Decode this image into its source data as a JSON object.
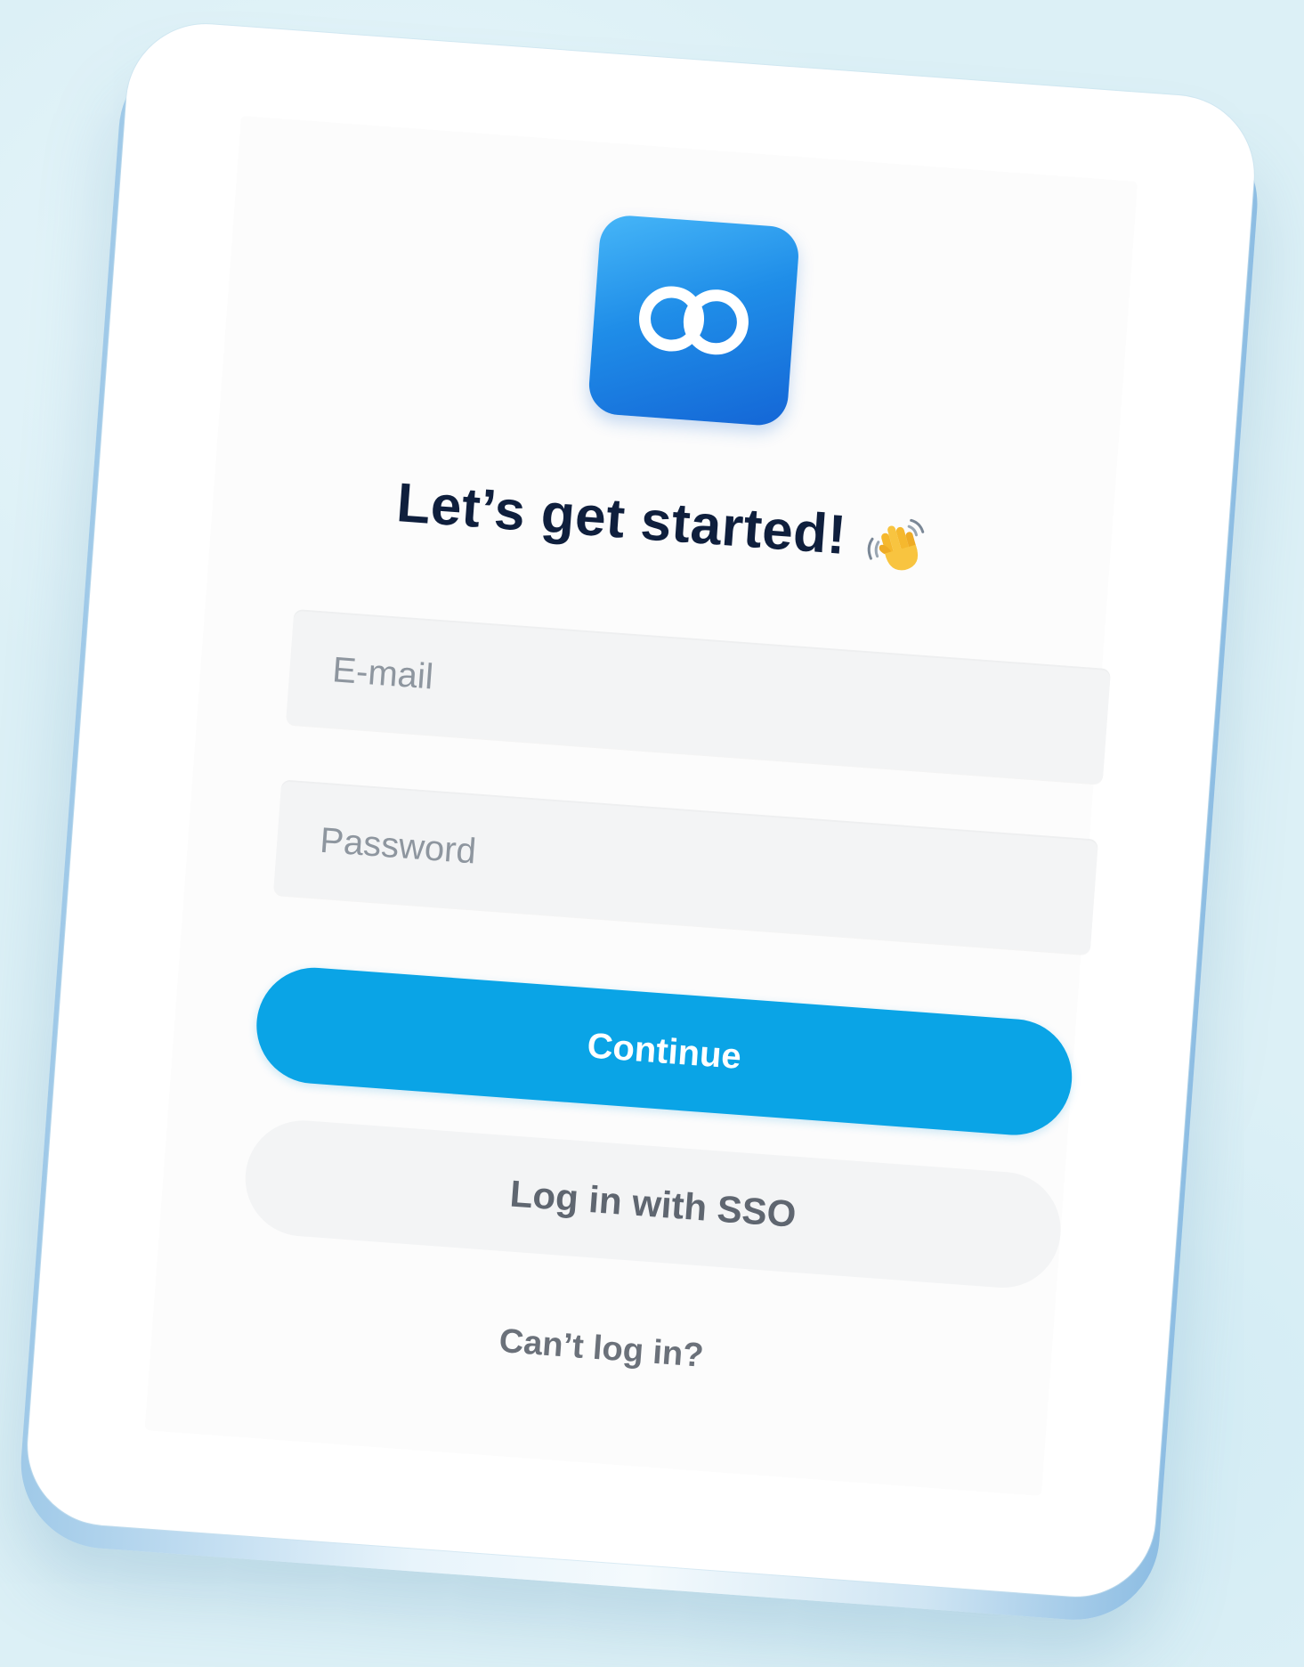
{
  "app": {
    "logo_icon": "infinity-icon",
    "brand_color": "#1f8de8"
  },
  "login": {
    "title": "Let’s get started!",
    "title_emoji": "waving-hand-icon",
    "email": {
      "placeholder": "E-mail",
      "value": ""
    },
    "password": {
      "placeholder": "Password",
      "value": ""
    },
    "continue_label": "Continue",
    "continue_color": "#0aa4e6",
    "sso_label": "Log in with SSO",
    "cant_login_label": "Can’t log in?"
  }
}
